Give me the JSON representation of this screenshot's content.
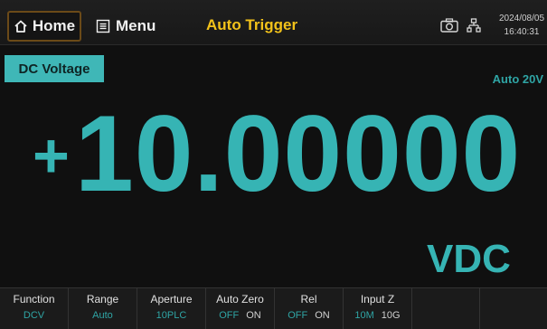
{
  "topbar": {
    "home_label": "Home",
    "menu_label": "Menu",
    "mode_title": "Auto Trigger",
    "date": "2024/08/05",
    "time": "16:40:31",
    "icons": [
      "home-icon",
      "menu-icon",
      "camera-icon",
      "network-icon"
    ]
  },
  "measurement": {
    "function_label": "DC Voltage",
    "range_label": "Auto 20V",
    "sign": "+",
    "value": "10.00000",
    "unit": "VDC"
  },
  "softkeys": [
    {
      "label": "Function",
      "value": "DCV"
    },
    {
      "label": "Range",
      "value": "Auto"
    },
    {
      "label": "Aperture",
      "value": "10PLC"
    },
    {
      "label": "Auto Zero",
      "options": [
        "OFF",
        "ON"
      ],
      "selected": "OFF"
    },
    {
      "label": "Rel",
      "options": [
        "OFF",
        "ON"
      ],
      "selected": "OFF"
    },
    {
      "label": "Input Z",
      "options": [
        "10M",
        "10G"
      ],
      "selected": "10M"
    }
  ],
  "colors": {
    "accent": "#36b4b4",
    "mode_title": "#f2c21a",
    "tag_bg": "#3fb7b7"
  }
}
